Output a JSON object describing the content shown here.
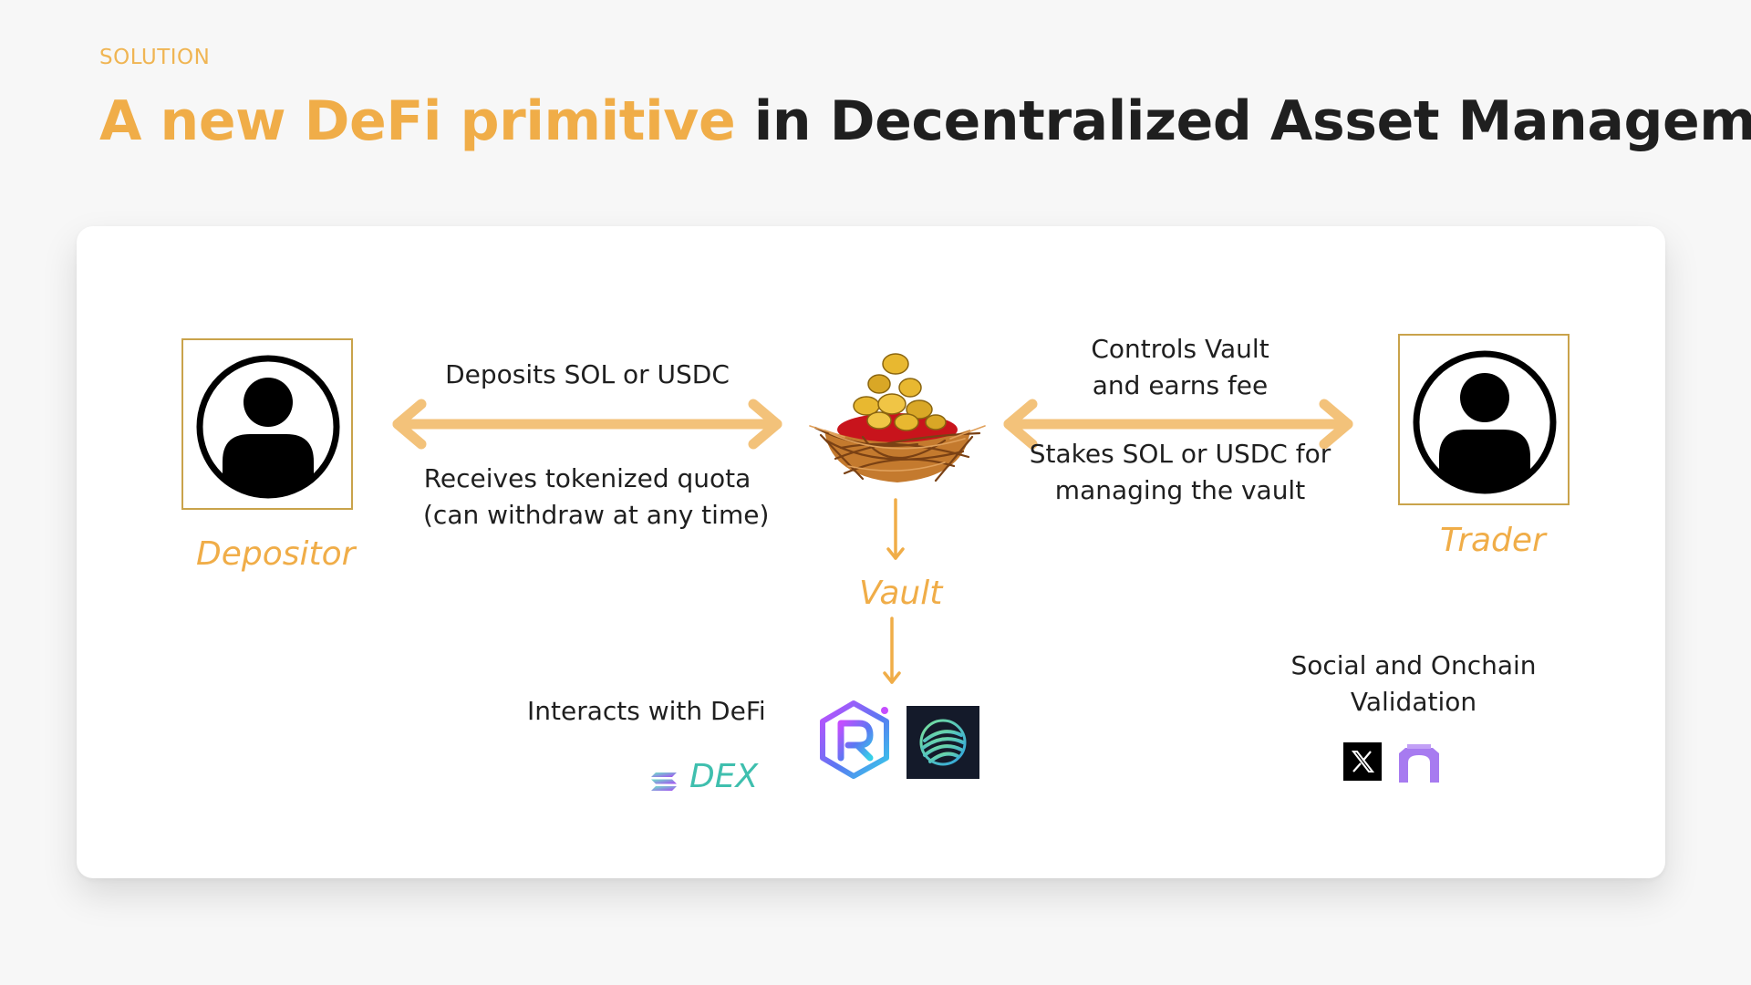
{
  "header": {
    "eyebrow": "SOLUTION",
    "title_highlight": "A new DeFi primitive",
    "title_rest": " in Decentralized Asset Management"
  },
  "diagram": {
    "depositor": {
      "label": "Depositor",
      "icon": "user-icon"
    },
    "trader": {
      "label": "Trader",
      "icon": "user-icon"
    },
    "vault": {
      "label": "Vault",
      "icon": "coin-nest-icon"
    },
    "left_flow": {
      "top_text": "Deposits SOL or USDC",
      "bottom_line1": "Receives tokenized quota",
      "bottom_line2": "(can withdraw at any time)"
    },
    "right_flow": {
      "top_line1": "Controls Vault",
      "top_line2": "and earns fee",
      "bottom_line1": "Stakes SOL or USDC for",
      "bottom_line2": "managing the vault"
    },
    "defi": {
      "text": "Interacts with DeFi",
      "dex_label": "DEX",
      "logos": [
        "raydium-logo",
        "drift-logo"
      ]
    },
    "validation": {
      "line1": "Social and Onchain",
      "line2": "Validation",
      "logos": [
        "x-logo",
        "arch-logo"
      ]
    }
  },
  "colors": {
    "accent": "#f0ad48",
    "arrow": "#f3c27a",
    "text": "#1f1f1f",
    "frame": "#c9a34b",
    "dex": "#3fbfae"
  }
}
